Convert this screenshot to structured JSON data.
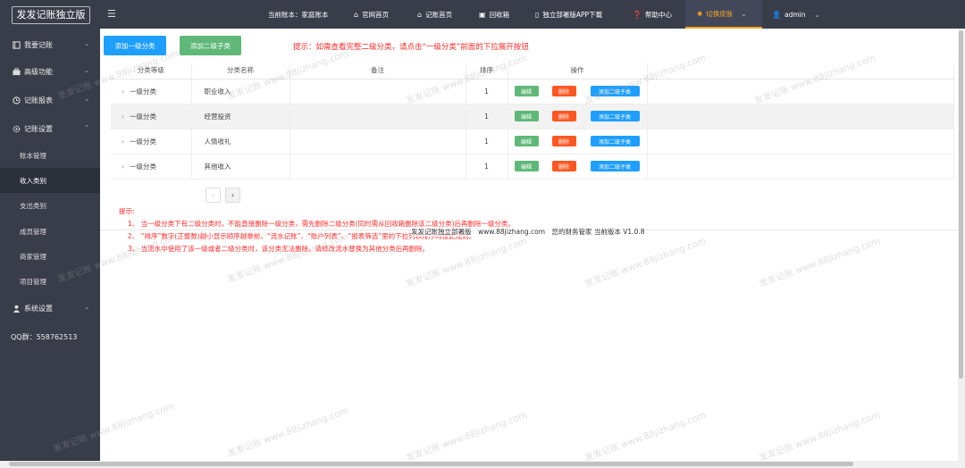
{
  "sidebar": {
    "logo": "发发记账独立版",
    "items": [
      {
        "label": "我要记账",
        "icon": "book-icon"
      },
      {
        "label": "高级功能",
        "icon": "briefcase-icon"
      },
      {
        "label": "记账报表",
        "icon": "clock-icon"
      },
      {
        "label": "记账设置",
        "icon": "gear-icon"
      }
    ],
    "subitems": [
      "账本管理",
      "收入类别",
      "支出类别",
      "成员管理",
      "商家管理",
      "项目管理"
    ],
    "system": {
      "label": "系统设置",
      "icon": "user-icon"
    },
    "qq": "QQ群：558762513"
  },
  "topbar": {
    "current_book": "当前账本：家庭账本",
    "links": [
      {
        "label": "官网首页",
        "icon": "home-icon"
      },
      {
        "label": "记账首页",
        "icon": "home-icon"
      },
      {
        "label": "回收箱",
        "icon": "trash-icon"
      },
      {
        "label": "独立部署版APP下载",
        "icon": "phone-icon"
      },
      {
        "label": "帮助中心",
        "icon": "help-icon"
      }
    ],
    "skin": "切换皮肤",
    "user": "admin"
  },
  "actions": {
    "add_level1": "添加一级分类",
    "add_level2": "添加二级子类"
  },
  "hint_top": "提示：如需查看完整二级分类，请点击“一级分类”前面的下拉展开按钮",
  "table": {
    "headers": [
      "分类等级",
      "分类名称",
      "备注",
      "排序",
      "操作"
    ],
    "rows": [
      {
        "level": "一级分类",
        "name": "职业收入",
        "note": "",
        "sort": "1"
      },
      {
        "level": "一级分类",
        "name": "经营投资",
        "note": "",
        "sort": "1"
      },
      {
        "level": "一级分类",
        "name": "人情收礼",
        "note": "",
        "sort": "1"
      },
      {
        "level": "一级分类",
        "name": "其他收入",
        "note": "",
        "sort": "1"
      }
    ],
    "op_labels": {
      "edit": "编辑",
      "del": "删除",
      "add": "添加二级子类"
    }
  },
  "pager": {
    "prev": "‹",
    "next": "›"
  },
  "tips": {
    "title": "提示:",
    "lines": [
      "1、 当一级分类下有二级分类时，不能直接删除一级分类，需先删除二级分类(同时需从回收箱删除该二级分类)后再删除一级分类。",
      "2、 “排序”数字(正整数)越小显示顺序越靠前，“流水记账”、“账户列表”、“报表筛选”里的下拉列表排序均按此规则。",
      "3、 当流水中使用了该一级或者二级分类时，该分类无法删除。请修改流水替换为其他分类后再删除。"
    ]
  },
  "footer": "发发记账独立部署版　www.88jizhang.com　您的财务管家 当前版本 V1.0.8",
  "watermark": "发发记账 www.88jizhang.com"
}
